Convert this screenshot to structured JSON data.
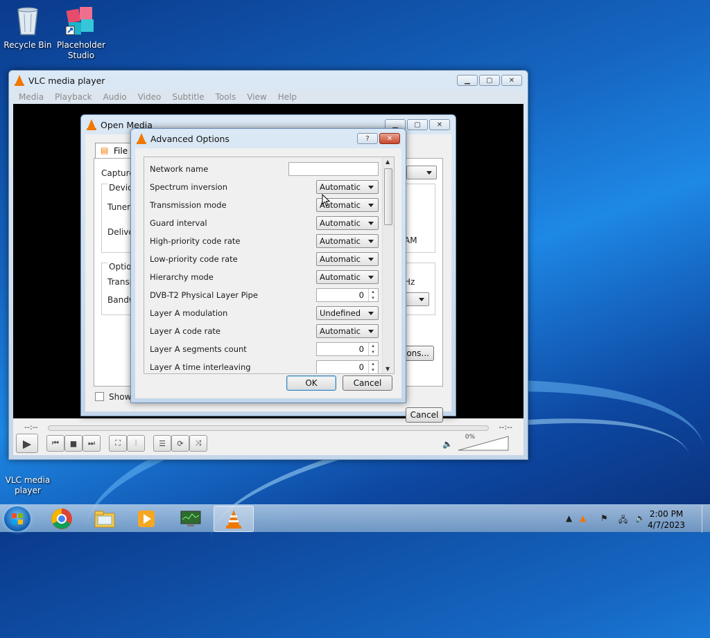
{
  "desktop": {
    "icons": [
      {
        "label": "Recycle Bin",
        "icon": "recycle-bin-icon"
      },
      {
        "label": "Placeholder Studio",
        "icon": "studio-icon"
      },
      {
        "label": "VLC media player",
        "icon": "vlc-icon"
      }
    ]
  },
  "vlc": {
    "title": "VLC media player",
    "menu": [
      "Media",
      "Playback",
      "Audio",
      "Video",
      "Subtitle",
      "Tools",
      "View",
      "Help"
    ],
    "time_left": "--:--",
    "time_right": "--:--",
    "volume": "0%"
  },
  "open_media": {
    "title": "Open Media",
    "tab_file": "File",
    "capture_label": "Capture",
    "device_group": "Device",
    "tuner_label": "Tuner",
    "delivery_label": "Deliver",
    "options_group": "Options",
    "transp_label": "Transp",
    "bandw_label": "Bandwi",
    "am_text": "AM",
    "hz_text": "Hz",
    "advanced_btn": "ions...",
    "show_more": "Show m",
    "cancel": "Cancel"
  },
  "advanced": {
    "title": "Advanced Options",
    "help_btn": "?",
    "rows": [
      {
        "label": "Network name",
        "type": "text",
        "value": ""
      },
      {
        "label": "Spectrum inversion",
        "type": "combo",
        "value": "Automatic"
      },
      {
        "label": "Transmission mode",
        "type": "combo",
        "value": "Automatic"
      },
      {
        "label": "Guard interval",
        "type": "combo",
        "value": "Automatic"
      },
      {
        "label": "High-priority code rate",
        "type": "combo",
        "value": "Automatic"
      },
      {
        "label": "Low-priority code rate",
        "type": "combo",
        "value": "Automatic"
      },
      {
        "label": "Hierarchy mode",
        "type": "combo",
        "value": "Automatic"
      },
      {
        "label": "DVB-T2 Physical Layer Pipe",
        "type": "spin",
        "value": "0"
      },
      {
        "label": "Layer A modulation",
        "type": "combo",
        "value": "Undefined"
      },
      {
        "label": "Layer A code rate",
        "type": "combo",
        "value": "Automatic"
      },
      {
        "label": "Layer A segments count",
        "type": "spin",
        "value": "0"
      },
      {
        "label": "Layer A time interleaving",
        "type": "spin",
        "value": "0"
      }
    ],
    "ok": "OK",
    "cancel": "Cancel"
  },
  "taskbar": {
    "time": "2:00 PM",
    "date": "4/7/2023"
  }
}
